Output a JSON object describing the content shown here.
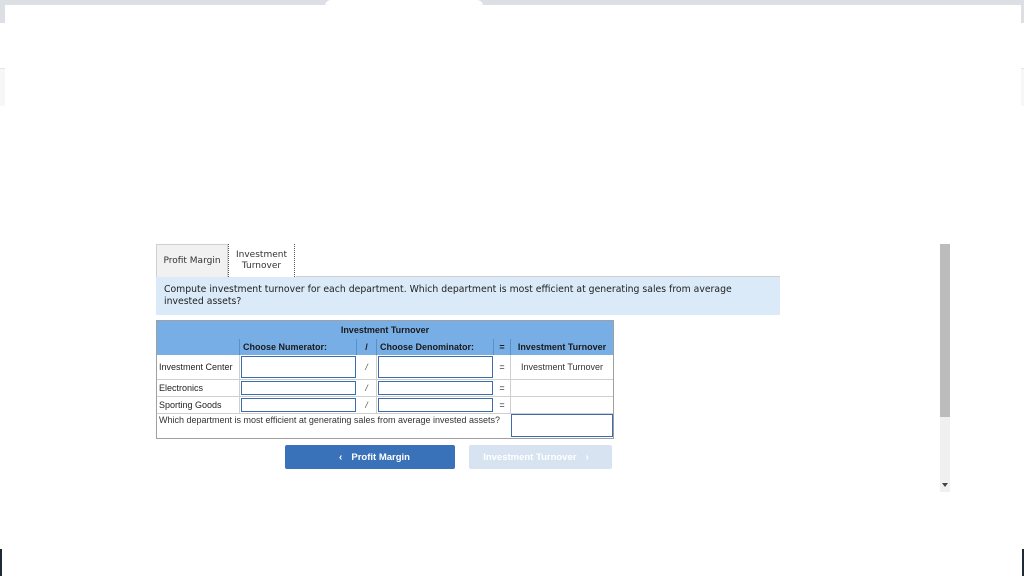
{
  "tabs": [
    {
      "label": "Profit Margin",
      "active": false
    },
    {
      "label": "Investment Turnover",
      "active": true
    }
  ],
  "prompt": "Compute investment turnover for each department. Which department is most efficient at generating sales from average invested assets?",
  "table": {
    "title": "Investment Turnover",
    "headers": {
      "numerator": "Choose Numerator:",
      "slash": "/",
      "denominator": "Choose Denominator:",
      "equals": "=",
      "result": "Investment Turnover"
    },
    "rows": [
      {
        "label": "Investment Center",
        "numerator": "",
        "slash": "/",
        "denominator": "",
        "equals": "=",
        "result": "Investment Turnover"
      },
      {
        "label": "Electronics",
        "numerator": "",
        "slash": "/",
        "denominator": "",
        "equals": "=",
        "result": ""
      },
      {
        "label": "Sporting Goods",
        "numerator": "",
        "slash": "/",
        "denominator": "",
        "equals": "=",
        "result": ""
      }
    ],
    "question": "Which department is most efficient at generating sales from average invested assets?",
    "answer": ""
  },
  "nav": {
    "prev_label": "Profit Margin",
    "prev_icon": "chevron-left",
    "next_label": "Investment Turnover",
    "next_icon": "chevron-right"
  },
  "colors": {
    "header_blue": "#78aee6",
    "prompt_bg": "#daeaf8",
    "primary_button": "#3a72ba",
    "disabled_button": "#d7e3f1"
  }
}
